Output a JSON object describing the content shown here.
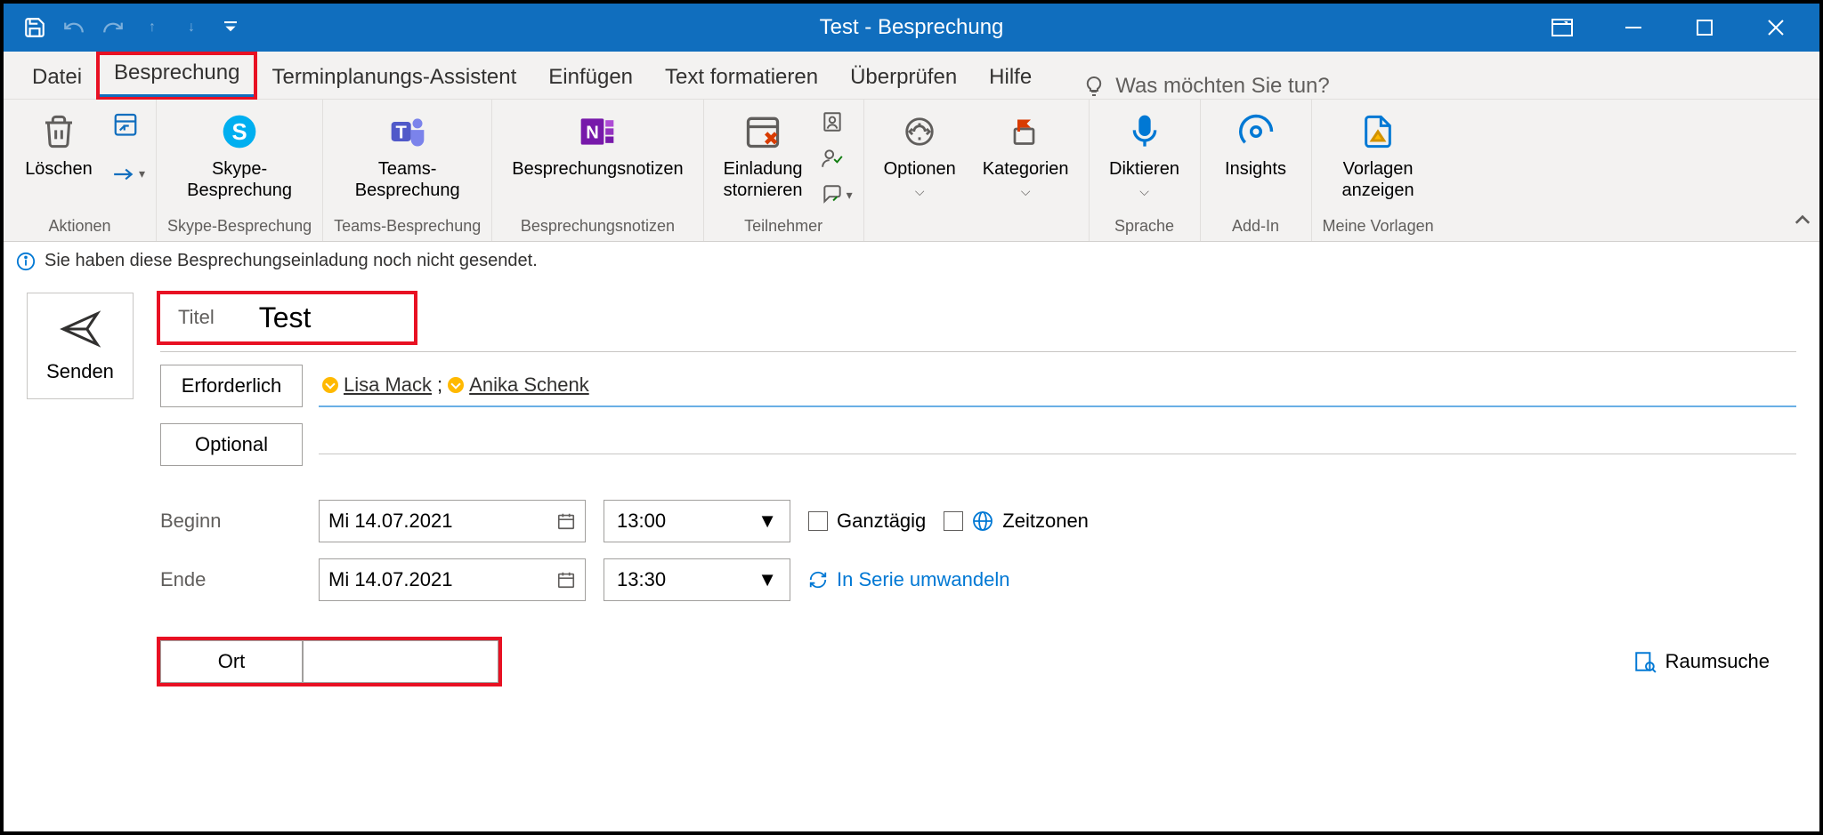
{
  "window": {
    "title": "Test  -  Besprechung"
  },
  "tabs": {
    "datei": "Datei",
    "besprechung": "Besprechung",
    "terminplanungs": "Terminplanungs-Assistent",
    "einfuegen": "Einfügen",
    "text_formatieren": "Text formatieren",
    "ueberpruefen": "Überprüfen",
    "hilfe": "Hilfe",
    "tell_me": "Was möchten Sie tun?"
  },
  "ribbon": {
    "aktionen": {
      "loeschen": "Löschen",
      "group": "Aktionen"
    },
    "skype": {
      "btn_l1": "Skype-",
      "btn_l2": "Besprechung",
      "group": "Skype-Besprechung"
    },
    "teams": {
      "btn_l1": "Teams-",
      "btn_l2": "Besprechung",
      "group": "Teams-Besprechung"
    },
    "notes": {
      "btn": "Besprechungsnotizen",
      "group": "Besprechungsnotizen"
    },
    "teilnehmer": {
      "btn_l1": "Einladung",
      "btn_l2": "stornieren",
      "group": "Teilnehmer"
    },
    "optionen": {
      "btn": "Optionen"
    },
    "kategorien": {
      "btn": "Kategorien"
    },
    "sprache": {
      "btn": "Diktieren",
      "group": "Sprache"
    },
    "addin": {
      "btn": "Insights",
      "group": "Add-In"
    },
    "vorlagen": {
      "btn_l1": "Vorlagen",
      "btn_l2": "anzeigen",
      "group": "Meine Vorlagen"
    }
  },
  "info_bar": "Sie haben diese Besprechungseinladung noch nicht gesendet.",
  "form": {
    "send": "Senden",
    "title_label": "Titel",
    "title_value": "Test",
    "erforderlich": "Erforderlich",
    "optional": "Optional",
    "beginn": "Beginn",
    "ende": "Ende",
    "ort": "Ort",
    "recipients_required": [
      {
        "name": "Lisa Mack"
      },
      {
        "name": "Anika Schenk"
      }
    ],
    "start_date": "Mi 14.07.2021",
    "start_time": "13:00",
    "end_date": "Mi 14.07.2021",
    "end_time": "13:30",
    "ganztagig": "Ganztägig",
    "zeitzonen": "Zeitzonen",
    "serie": "In Serie umwandeln",
    "raumsuche": "Raumsuche"
  }
}
